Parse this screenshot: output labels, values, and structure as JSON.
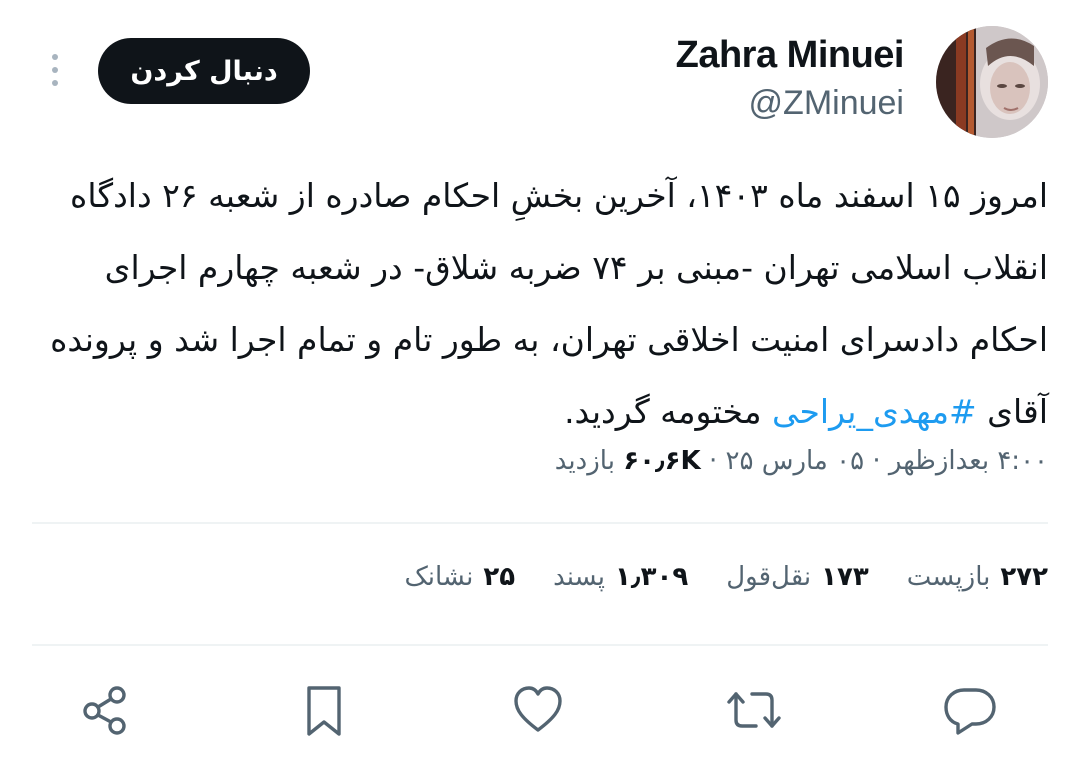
{
  "author": {
    "name": "Zahra Minuei",
    "handle": "@ZMinuei",
    "follow_label": "دنبال کردن"
  },
  "tweet": {
    "text_before": "امروز ۱۵ اسفند ماه ۱۴۰۳، آخرین بخشِ احکام صادره از شعبه ۲۶ دادگاه انقلاب اسلامی تهران -مبنی بر ۷۴ ضربه شلاق- در شعبه چهارم اجرای احکام دادسرای امنیت اخلاقی تهران، به طور تام و تمام اجرا شد و پرونده آقای ",
    "hashtag": "#مهدی_یراحی",
    "text_after": " مختومه گردید."
  },
  "meta": {
    "time": "۴:۰۰ بعدازظهر",
    "date": "۰۵ مارس ۲۵",
    "views_count": "۶۰٫۶K",
    "views_label": "بازدید",
    "separator": "·"
  },
  "stats": {
    "reposts_count": "۲۷۲",
    "reposts_label": "بازپست",
    "quotes_count": "۱۷۳",
    "quotes_label": "نقل‌قول",
    "likes_count": "۱٫۳۰۹",
    "likes_label": "پسند",
    "bookmarks_count": "۲۵",
    "bookmarks_label": "نشانک"
  },
  "icons": {
    "reply": "reply-icon",
    "repost": "repost-icon",
    "like": "heart-icon",
    "bookmark": "bookmark-icon",
    "share": "share-icon",
    "more": "more-vertical-icon"
  },
  "colors": {
    "text": "#0f1419",
    "secondary": "#536471",
    "hashtag": "#1d9bf0",
    "divider": "#eff3f4",
    "icon": "#536471"
  }
}
